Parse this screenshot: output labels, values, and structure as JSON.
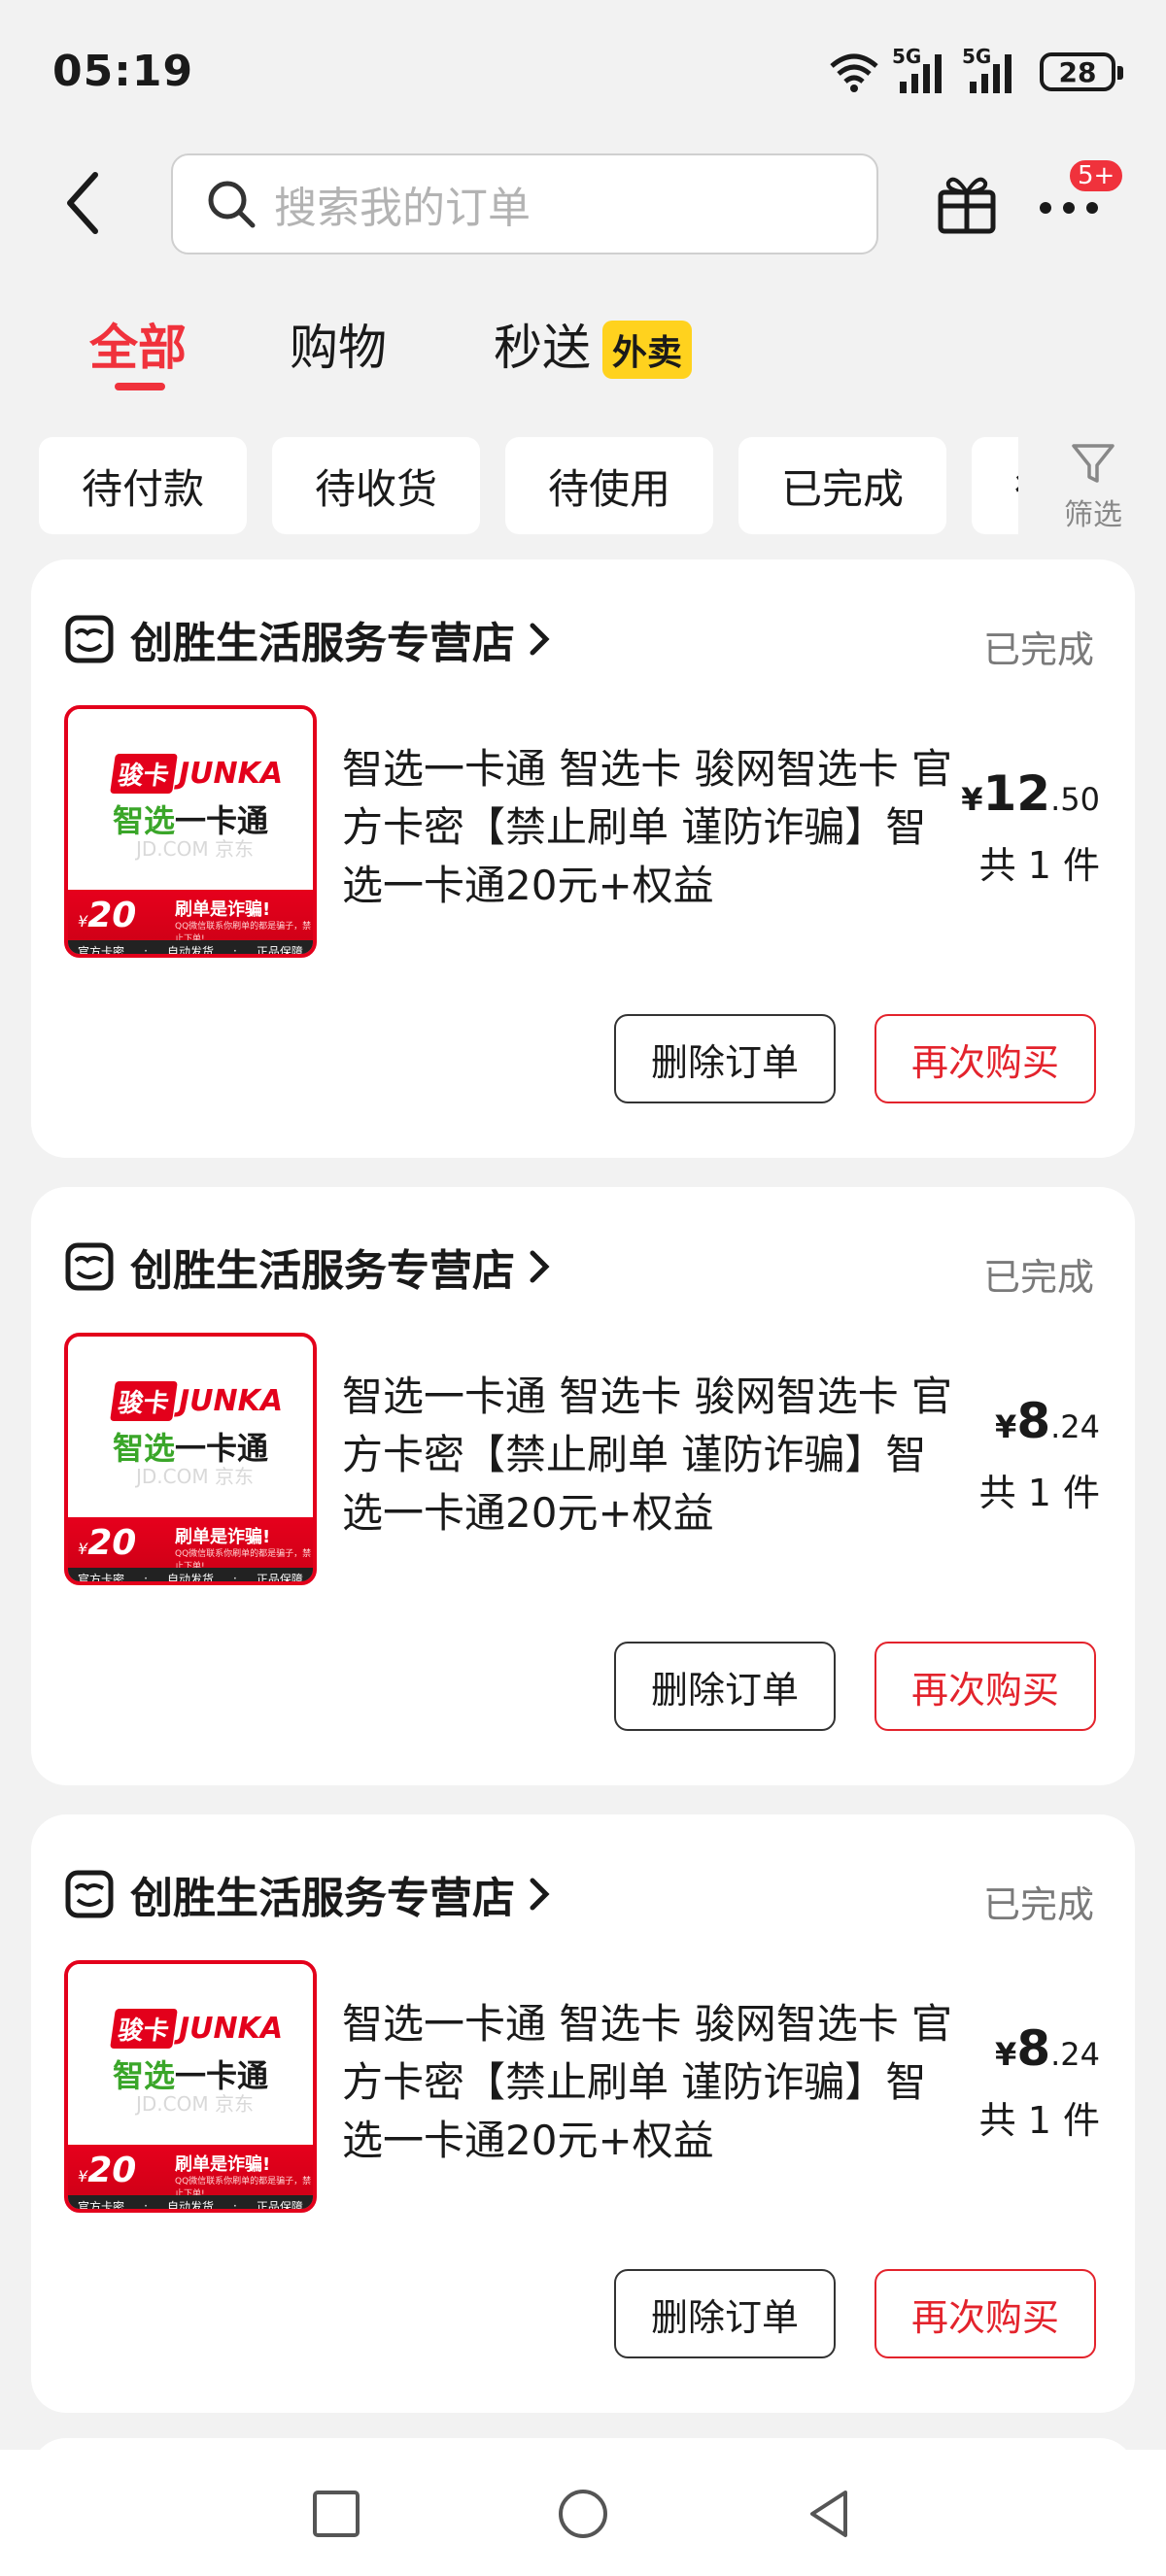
{
  "status_bar": {
    "time": "05:19",
    "network_label_1": "5G",
    "network_label_2": "5G",
    "battery": "28"
  },
  "search": {
    "placeholder": "搜索我的订单",
    "notification_badge": "5+"
  },
  "main_tabs": [
    {
      "label": "全部",
      "active": true
    },
    {
      "label": "购物",
      "active": false
    },
    {
      "label": "秒送",
      "active": false,
      "tag": "外卖"
    }
  ],
  "filter_chips": [
    {
      "label": "待付款"
    },
    {
      "label": "待收货"
    },
    {
      "label": "待使用"
    },
    {
      "label": "已完成"
    },
    {
      "label": "待评价"
    }
  ],
  "filter_button_label": "筛选",
  "orders": [
    {
      "store_name": "创胜生活服务专营店",
      "status": "已完成",
      "title": "智选一卡通 智选卡 骏网智选卡 官方卡密【禁止刷单 谨防诈骗】智选一卡通20元+权益",
      "price_currency": "¥",
      "price_int": "12",
      "price_dec": ".50",
      "quantity": "共 1 件",
      "delete_label": "删除订单",
      "rebuy_label": "再次购买"
    },
    {
      "store_name": "创胜生活服务专营店",
      "status": "已完成",
      "title": "智选一卡通 智选卡 骏网智选卡 官方卡密【禁止刷单 谨防诈骗】智选一卡通20元+权益",
      "price_currency": "¥",
      "price_int": "8",
      "price_dec": ".24",
      "quantity": "共 1 件",
      "delete_label": "删除订单",
      "rebuy_label": "再次购买"
    },
    {
      "store_name": "创胜生活服务专营店",
      "status": "已完成",
      "title": "智选一卡通 智选卡 骏网智选卡 官方卡密【禁止刷单 谨防诈骗】智选一卡通20元+权益",
      "price_currency": "¥",
      "price_int": "8",
      "price_dec": ".24",
      "quantity": "共 1 件",
      "delete_label": "删除订单",
      "rebuy_label": "再次购买"
    }
  ],
  "product_image": {
    "brand_tag": "骏卡",
    "brand_name": "JUNKA",
    "card_name_green": "智选",
    "card_name_black": "一卡通",
    "watermark": "JD.COM 京东",
    "currency": "¥",
    "face_value": "20",
    "warning": "刷单是诈骗!",
    "warning_sub": "QQ微信联系你刷单的都是骗子，禁止下单!",
    "footer_1": "官方卡密",
    "footer_2": "自动发货",
    "footer_3": "正品保障"
  },
  "colors": {
    "accent_red": "#f0323c",
    "rebuy_red": "#e3232c",
    "background": "#f2f2f2",
    "waimai_yellow": "#ffd21e"
  }
}
